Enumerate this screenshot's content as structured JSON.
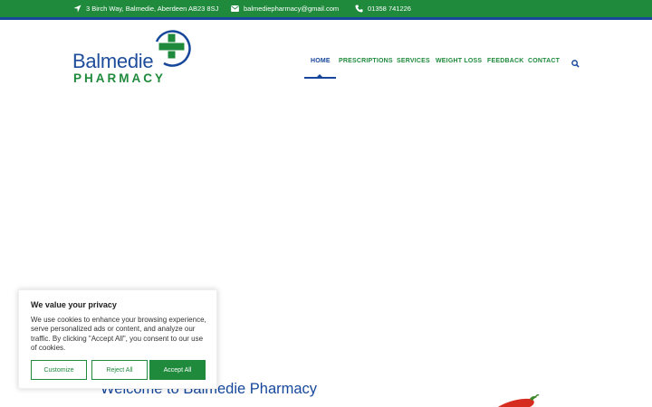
{
  "topbar": {
    "address": "3 Birch Way, Balmedie, Aberdeen AB23 8SJ",
    "email": "balmediepharmacy@gmail.com",
    "phone": "01358 741226",
    "address_icon": "location-arrow-icon",
    "email_icon": "envelope-icon",
    "phone_icon": "phone-icon"
  },
  "logo": {
    "name": "Balmedie",
    "subtitle": "PHARMACY"
  },
  "nav": {
    "items": [
      {
        "label": "HOME",
        "active": true
      },
      {
        "label": "PRESCRIPTIONS",
        "active": false
      },
      {
        "label": "SERVICES",
        "active": false
      },
      {
        "label": "WEIGHT LOSS",
        "active": false
      },
      {
        "label": "FEEDBACK",
        "active": false
      },
      {
        "label": "CONTACT",
        "active": false
      }
    ],
    "search_icon": "search-icon"
  },
  "hero": {
    "heading": "Welcome to Balmedie Pharmacy"
  },
  "cookie": {
    "title": "We value your privacy",
    "text": "We use cookies to enhance your browsing experience, serve personalized ads or content, and analyze our traffic. By clicking \"Accept All\", you consent to our use of cookies.",
    "customize_label": "Customize",
    "reject_label": "Reject All",
    "accept_label": "Accept All"
  },
  "colors": {
    "brand_green": "#1f8a3c",
    "brand_blue": "#16479b"
  }
}
